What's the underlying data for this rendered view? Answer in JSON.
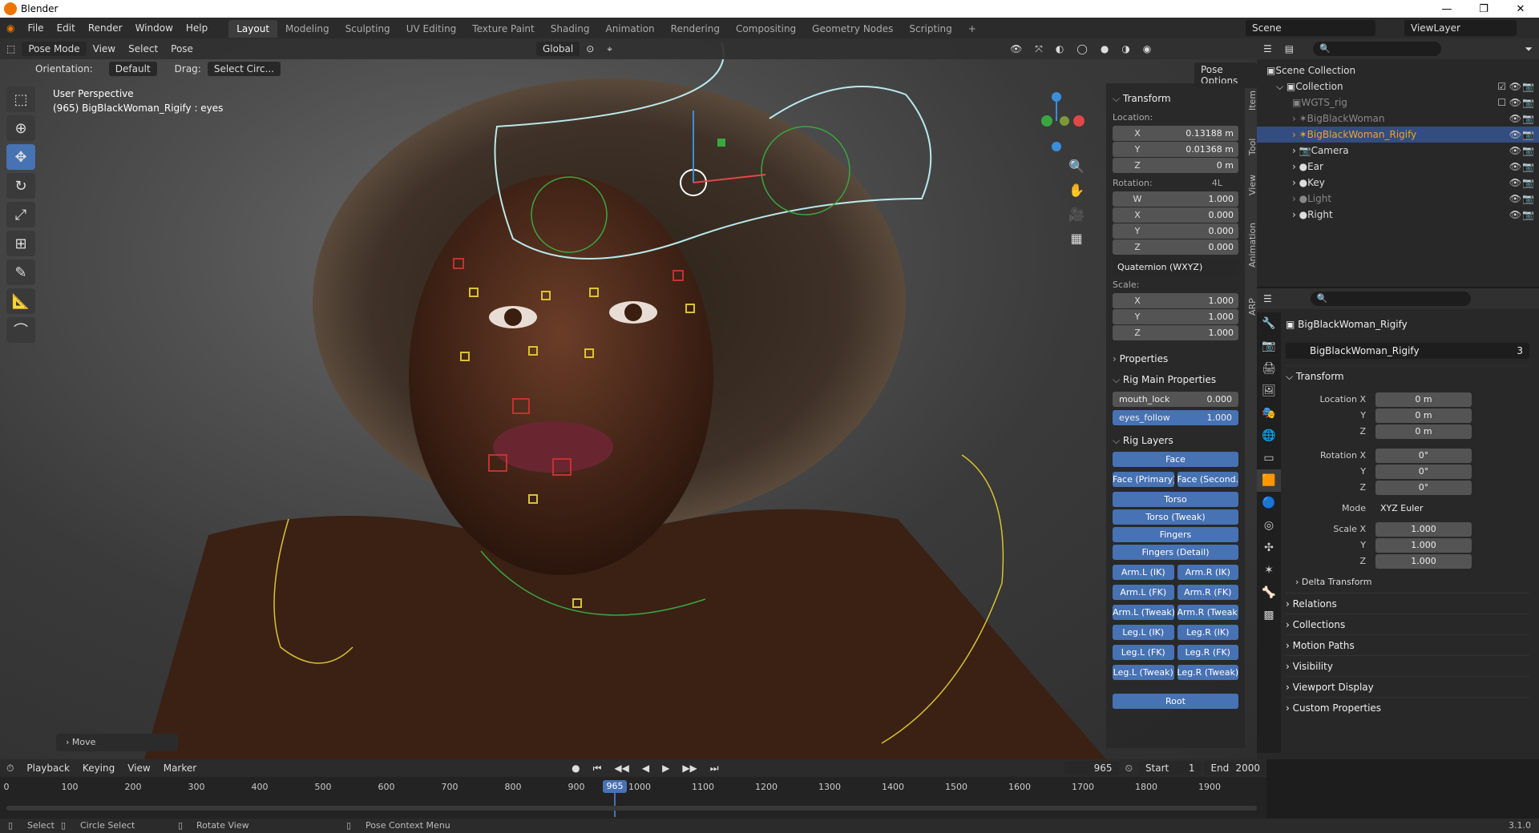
{
  "window": {
    "title": "Blender"
  },
  "menu": [
    "File",
    "Edit",
    "Render",
    "Window",
    "Help"
  ],
  "workspaces": [
    "Layout",
    "Modeling",
    "Sculpting",
    "UV Editing",
    "Texture Paint",
    "Shading",
    "Animation",
    "Rendering",
    "Compositing",
    "Geometry Nodes",
    "Scripting"
  ],
  "scene": "Scene",
  "view_layer": "ViewLayer",
  "viewport": {
    "mode": "Pose Mode",
    "view": "View",
    "select": "Select",
    "pose": "Pose",
    "orientation_label": "Orientation:",
    "orientation": "Default",
    "drag_label": "Drag:",
    "drag": "Select Circ...",
    "transform_orientation": "Global",
    "pose_options": "Pose Options",
    "info_line1": "User Perspective",
    "info_line2": "(965) BigBlackWoman_Rigify : eyes",
    "last_op": "Move"
  },
  "npanel": {
    "tabs": [
      "Item",
      "Tool",
      "View",
      "Animation",
      "ARP"
    ],
    "transform": "Transform",
    "location_label": "Location:",
    "location": [
      {
        "k": "X",
        "v": "0.13188 m"
      },
      {
        "k": "Y",
        "v": "0.01368 m"
      },
      {
        "k": "Z",
        "v": "0 m"
      }
    ],
    "rotation_label": "Rotation:",
    "rotation_mode_short": "4L",
    "rotation": [
      {
        "k": "W",
        "v": "1.000"
      },
      {
        "k": "X",
        "v": "0.000"
      },
      {
        "k": "Y",
        "v": "0.000"
      },
      {
        "k": "Z",
        "v": "0.000"
      }
    ],
    "rotation_mode": "Quaternion (WXYZ)",
    "scale_label": "Scale:",
    "scale": [
      {
        "k": "X",
        "v": "1.000"
      },
      {
        "k": "Y",
        "v": "1.000"
      },
      {
        "k": "Z",
        "v": "1.000"
      }
    ],
    "properties": "Properties",
    "rig_main": "Rig Main Properties",
    "mouth_lock": {
      "k": "mouth_lock",
      "v": "0.000"
    },
    "eyes_follow": {
      "k": "eyes_follow",
      "v": "1.000"
    },
    "rig_layers": "Rig Layers",
    "layers": {
      "face": "Face",
      "face_primary": "Face (Primary)",
      "face_secondary": "Face (Second...",
      "torso": "Torso",
      "torso_tweak": "Torso (Tweak)",
      "fingers": "Fingers",
      "fingers_detail": "Fingers (Detail)",
      "arm_l_ik": "Arm.L (IK)",
      "arm_r_ik": "Arm.R (IK)",
      "arm_l_fk": "Arm.L (FK)",
      "arm_r_fk": "Arm.R (FK)",
      "arm_l_tweak": "Arm.L (Tweak)",
      "arm_r_tweak": "Arm.R (Tweak)",
      "leg_l_ik": "Leg.L (IK)",
      "leg_r_ik": "Leg.R (IK)",
      "leg_l_fk": "Leg.L (FK)",
      "leg_r_fk": "Leg.R (FK)",
      "leg_l_tweak": "Leg.L (Tweak)",
      "leg_r_tweak": "Leg.R (Tweak)",
      "root": "Root"
    }
  },
  "outliner": {
    "scene_collection": "Scene Collection",
    "collection": "Collection",
    "items": [
      "WGTS_rig",
      "BigBlackWoman",
      "BigBlackWoman_Rigify",
      "Camera",
      "Ear",
      "Key",
      "Light",
      "Right"
    ]
  },
  "properties": {
    "object_name": "BigBlackWoman_Rigify",
    "data_name": "BigBlackWoman_Rigify",
    "users": "3",
    "transform": "Transform",
    "loc_x_label": "Location X",
    "loc_x": "0 m",
    "y_label": "Y",
    "loc_y": "0 m",
    "z_label": "Z",
    "loc_z": "0 m",
    "rot_x_label": "Rotation X",
    "rot_x": "0°",
    "rot_y": "0°",
    "rot_z": "0°",
    "mode_label": "Mode",
    "mode": "XYZ Euler",
    "scale_x_label": "Scale X",
    "scale_x": "1.000",
    "scale_y": "1.000",
    "scale_z": "1.000",
    "delta": "Delta Transform",
    "sections": [
      "Relations",
      "Collections",
      "Motion Paths",
      "Visibility",
      "Viewport Display",
      "Custom Properties"
    ]
  },
  "timeline": {
    "playback": "Playback",
    "keying": "Keying",
    "view": "View",
    "marker": "Marker",
    "current": "965",
    "start_label": "Start",
    "start": "1",
    "end_label": "End",
    "end": "2000",
    "ticks": [
      "0",
      "100",
      "200",
      "300",
      "400",
      "500",
      "600",
      "700",
      "800",
      "900",
      "1000",
      "1100",
      "1200",
      "1300",
      "1400",
      "1500",
      "1600",
      "1700",
      "1800",
      "1900"
    ]
  },
  "status": {
    "select": "Select",
    "circle_select": "Circle Select",
    "rotate_view": "Rotate View",
    "pose_menu": "Pose Context Menu",
    "version": "3.1.0"
  }
}
